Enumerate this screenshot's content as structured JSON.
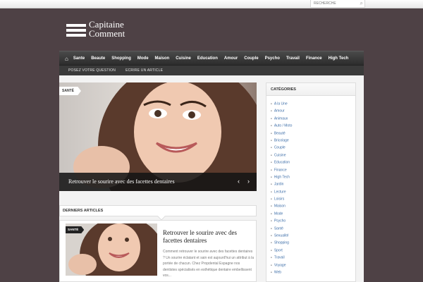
{
  "search": {
    "placeholder": "RECHERCHE",
    "icon": "search-icon"
  },
  "site": {
    "logo_line1": "Capitaine",
    "logo_line2": "Comment"
  },
  "nav": {
    "home_icon": "home-icon",
    "items": [
      "Sante",
      "Beaute",
      "Shopping",
      "Mode",
      "Maison",
      "Cuisine",
      "Education",
      "Amour",
      "Couple",
      "Psycho",
      "Travail",
      "Finance",
      "High Tech"
    ]
  },
  "subnav": {
    "items": [
      "POSEZ VOTRE QUESTION",
      "ECRIRE UN ARTICLE"
    ]
  },
  "slider": {
    "category": "SANTÉ",
    "title": "Retrouver le sourire avec des facettes dentaires",
    "prev": "‹",
    "next": "›"
  },
  "latest": {
    "heading": "DERNIERS ARTICLES",
    "post": {
      "category": "SANTÉ",
      "title": "Retrouver le sourire avec des facettes dentaires",
      "excerpt": "Comment retrouver le sourire avec des facettes dentaires ? Un sourire éclatant et sain est aujourd'hui un attribut à la portée de chacun. Chez Propdental Espagne nos dentistes spécialisés en esthétique dentaire embellissent vos..."
    }
  },
  "sidebar": {
    "heading": "CATÉGORIES",
    "categories": [
      "A la Une",
      "Amour",
      "Animaux",
      "Auto / Moto",
      "Beauté",
      "Bricolage",
      "Couple",
      "Cuisine",
      "Education",
      "Finance",
      "High Tech",
      "Jardin",
      "Lecture",
      "Loisirs",
      "Maison",
      "Mode",
      "Psycho",
      "Santé",
      "Sexualité",
      "Shopping",
      "Sport",
      "Travail",
      "Voyage",
      "Web"
    ]
  },
  "colors": {
    "background": "#4e4145",
    "link": "#3d6ea8",
    "nav": "#333333"
  }
}
